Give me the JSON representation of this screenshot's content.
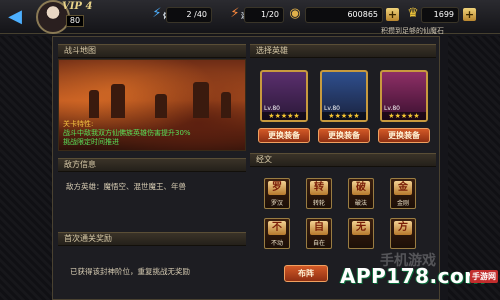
{
  "header": {
    "vip": "VIP 4",
    "level": "80",
    "stamina": "2 /40",
    "stamina_icon_label": "体",
    "energy": "1/20",
    "energy_icon_label": "活",
    "coins": "600865",
    "gold": "1699",
    "subtitle": "积攒到足够的仙魔石"
  },
  "battle_map": {
    "title": "战斗地图",
    "trait_label": "关卡特性:",
    "trait_line1": "战斗中敌我双方仙佛族英雄伤害提升30%",
    "trait_line2": "挑战限定时间推进"
  },
  "enemy_info": {
    "title": "敌方信息",
    "line": "敌方英雄：魔悟空、混世魔王、年兽"
  },
  "first_clear": {
    "title": "首次通关奖励",
    "line": "已获得该封神阶位，重复挑战无奖励"
  },
  "heroes": {
    "title": "选择英雄",
    "cards": [
      {
        "level": "Lv.80",
        "stars": "★★★★★",
        "button": "更换装备"
      },
      {
        "level": "Lv.80",
        "stars": "★★★★★",
        "button": "更换装备"
      },
      {
        "level": "Lv.80",
        "stars": "★★★★★",
        "button": "更换装备"
      }
    ]
  },
  "scriptures": {
    "title": "经文",
    "items": [
      {
        "glyph": "罗",
        "label": "罗汉"
      },
      {
        "glyph": "转",
        "label": "转轮"
      },
      {
        "glyph": "破",
        "label": "破法"
      },
      {
        "glyph": "金",
        "label": "金刚"
      },
      {
        "glyph": "不",
        "label": "不动"
      },
      {
        "glyph": "自",
        "label": "自在"
      },
      {
        "glyph": "无",
        "label": ""
      },
      {
        "glyph": "方",
        "label": ""
      }
    ],
    "formation_button": "布阵"
  },
  "watermark": {
    "text": "APP178.com",
    "tag": "手游网",
    "faded": "手机游戏"
  }
}
